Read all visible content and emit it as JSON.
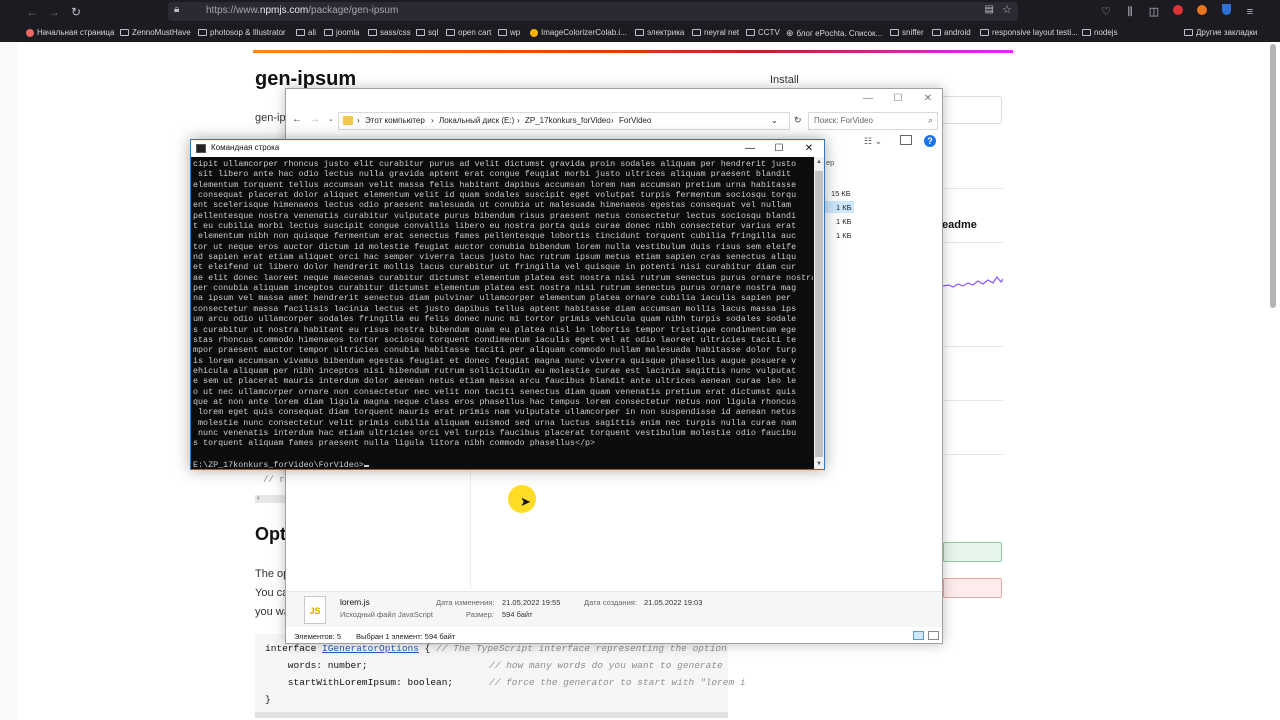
{
  "browser": {
    "url_prefix": "https://www.",
    "url_domain": "npmjs.com",
    "url_path": "/package/gen-ipsum",
    "bookmarks": [
      "Начальная страница",
      "ZennoMustHave",
      "photosop & Illustrator",
      "ali",
      "joomla",
      "sass/css",
      "sql",
      "open cart",
      "wp",
      "ImageColorizerColab.i...",
      "электрика",
      "neyral net",
      "CCTV",
      "блог ePochta. Список...",
      "sniffer",
      "android",
      "responsive layout testi...",
      "nodejs",
      "Другие закладки"
    ]
  },
  "npm": {
    "title": "gen-ipsum",
    "install_label": "Install",
    "frag_genip": "gen-ip",
    "readme": "eadme",
    "opt_title": "Opt",
    "frag_the": "The op",
    "frag_you": "You ca",
    "frag_youw": "you wa",
    "cmd_behind_1": "// r",
    "code": {
      "l1_kw": "interface ",
      "l1_name": "IGeneratorOptions",
      "l1_rest": " { ",
      "l1_comment": "// The TypeScript interface representing the option",
      "l2_field": "    words: number;",
      "l2_comment": "// how many words do you want to generate",
      "l3_field": "    startWithLoremIpsum: boolean;",
      "l3_comment": "// force the generator to start with \"lorem i",
      "l4": "}"
    }
  },
  "explorer": {
    "breadcrumbs": [
      "Этот компьютер",
      "Локальный диск (E:)",
      "ZP_17konkurs_forVideo",
      "ForVideo"
    ],
    "search_placeholder": "Поиск: ForVideo",
    "col_header_frag": "ер",
    "sizes": [
      "15 КБ",
      "1 КБ",
      "1 КБ",
      "1 КБ"
    ],
    "detail": {
      "file_name": "lorem.js",
      "file_type": "Исходный файл JavaScript",
      "modified_label": "Дата изменения:",
      "modified_value": "21.05.2022 19:55",
      "created_label": "Дата создания:",
      "created_value": "21.05.2022 19:03",
      "size_label": "Размер:",
      "size_value": "594 байт",
      "icon_text": "JS"
    },
    "status_items": "Элементов: 5",
    "status_selected": "Выбран 1 элемент: 594 байт"
  },
  "cmd": {
    "title": "Командная строка",
    "lines": [
      "cipit ullamcorper rhoncus justo elit curabitur purus ad velit dictumst gravida proin sodales aliquam per hendrerit justo",
      " sit libero ante hac odio lectus nulla gravida aptent erat congue feugiat morbi justo ultrices aliquam praesent blandit",
      "elementum torquent tellus accumsan velit massa felis habitant dapibus accumsan lorem nam accumsan pretium urna habitasse",
      " consequat placerat dolor aliquet elementum velit id quam sodales suscipit eget volutpat turpis fermentum sociosqu torqu",
      "ent scelerisque himenaeos lectus odio praesent malesuada ut conubia ut malesuada himenaeos egestas consequat vel nullam",
      "pellentesque nostra venenatis curabitur vulputate purus bibendum risus praesent netus consectetur lectus sociosqu blandi",
      "t eu cubilia morbi lectus suscipit congue convallis libero eu nostra porta quis curae donec nibh consectetur varius erat",
      " elementum nibh non quisque fermentum erat senectus fames pellentesque lobortis tincidunt torquent cubilia fringilla auc",
      "tor ut neque eros auctor dictum id molestie feugiat auctor conubia bibendum lorem nulla vestibulum duis risus sem eleife",
      "nd sapien erat etiam aliquet orci hac semper viverra lacus justo hac rutrum ipsum metus etiam sapien cras senectus aliqu",
      "et eleifend ut libero dolor hendrerit mollis lacus curabitur ut fringilla vel quisque in potenti nisi curabitur diam cur",
      "ae elit donec laoreet neque maecenas curabitur dictumst elementum platea est nostra nisi rutrum senectus purus ornare nostra mag",
      "per conubia aliquam inceptos curabitur dictumst elementum platea est nostra nisi rutrum senectus purus ornare nostra mag",
      "na ipsum vel massa amet hendrerit senectus diam pulvinar ullamcorper elementum platea ornare cubilia iaculis sapien per",
      "consectetur massa facilisis lacinia lectus et justo dapibus tellus aptent habitasse diam accumsan mollis lacus massa ips",
      "um arcu odio ullamcorper sodales fringilla eu felis donec nunc mi tortor primis vehicula quam nibh turpis sodales sodale",
      "s curabitur ut nostra habitant eu risus nostra bibendum quam eu platea nisl in lobortis tempor tristique condimentum ege",
      "stas rhoncus commodo himenaeos tortor sociosqu torquent condimentum iaculis eget vel at odio laoreet ultricies taciti te",
      "mpor praesent auctor tempor ultricies conubia habitasse taciti per aliquam commodo nullam malesuada habitasse dolor turp",
      "is lorem accumsan vivamus bibendum egestas feugiat et donec feugiat magna nunc viverra quisque phasellus augue posuere v",
      "ehicula aliquam per nibh inceptos nisi bibendum rutrum sollicitudin eu molestie curae est lacinia sagittis nunc vulputat",
      "e sem ut placerat mauris interdum dolor aenean netus etiam massa arcu faucibus blandit ante ultrices aenean curae leo le",
      "o ut nec ullamcorper ornare non consectetur nec velit non taciti senectus diam quam venenatis pretium erat dictumst quis",
      "que at non ante lorem diam ligula magna neque class eros phasellus hac tempus lorem consectetur netus non ligula rhoncus",
      " lorem eget quis consequat diam torquent mauris erat primis nam vulputate ullamcorper in non suspendisse id aenean netus",
      " molestie nunc consectetur velit primis cubilia aliquam euismod sed urna luctus sagittis enim nec turpis nulla curae nam",
      " nunc venenatis interdum hac etiam ultricies orci vel turpis faucibus placerat torquent vestibulum molestie odio faucibu",
      "s torquent aliquam fames praesent nulla ligula litora nibh commodo phasellus</p>"
    ],
    "prompt": "E:\\ZP_17konkurs_forVideo\\ForVideo>"
  }
}
